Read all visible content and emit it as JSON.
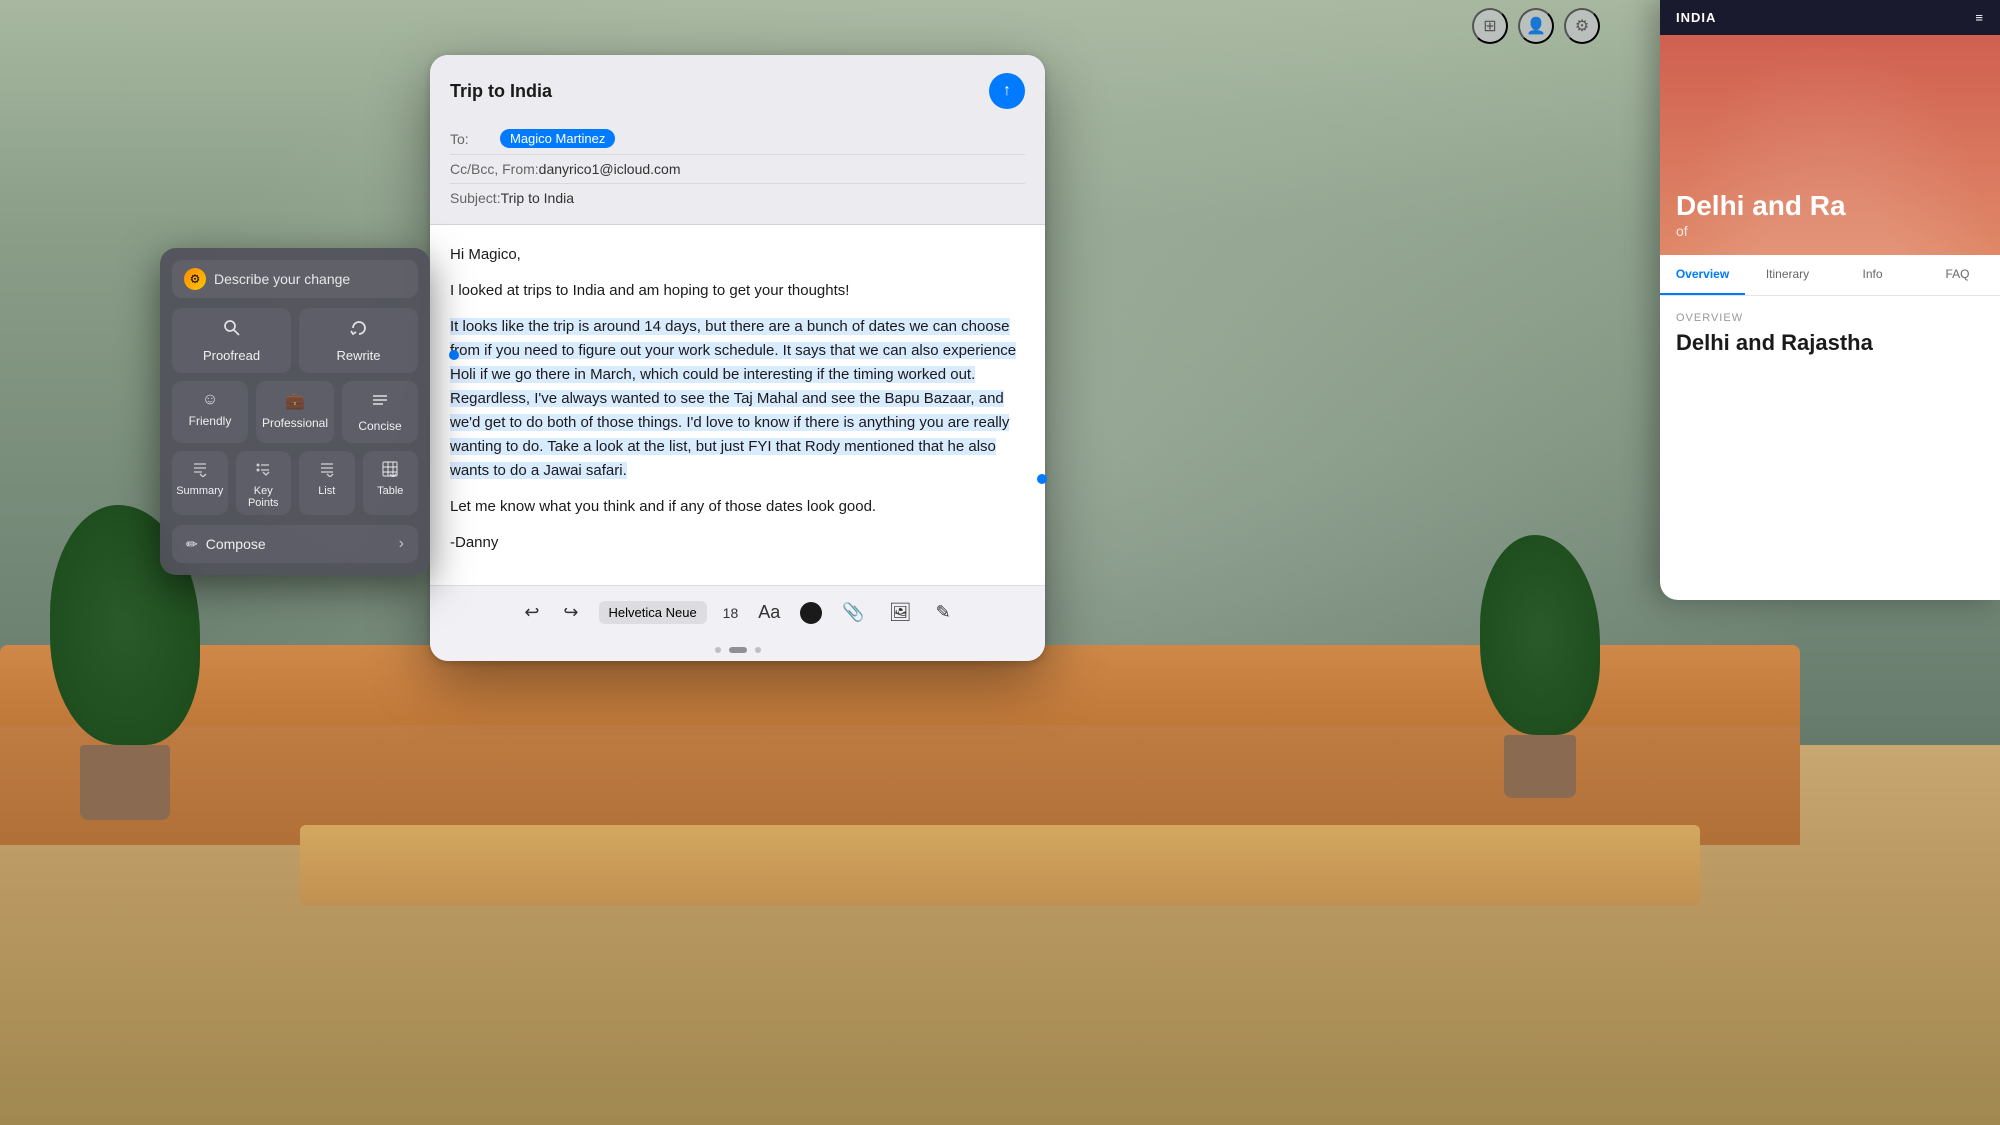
{
  "background": {
    "color": "#7a9e8a"
  },
  "top_controls": {
    "btn1_icon": "⊞",
    "btn2_icon": "👤",
    "btn3_icon": "⚙"
  },
  "email_window": {
    "title": "Trip to India",
    "send_icon": "↑",
    "to_label": "To:",
    "recipient": "Magico Martinez",
    "ccbcc_label": "Cc/Bcc, From:",
    "from_email": "danyrico1@icloud.com",
    "subject_label": "Subject:",
    "subject": "Trip to India",
    "greeting": "Hi Magico,",
    "line1": "I looked at trips to India and am hoping to get your thoughts!",
    "selected_paragraph": "It looks like the trip is around 14 days, but there are a bunch of dates we can choose from if you need to figure out your work schedule. It says that we can also experience Holi if we go there in March, which could be interesting if the timing worked out. Regardless, I've always wanted to see the Taj Mahal and see the Bapu Bazaar, and we'd get to do both of those things.  I'd love to know if there is anything you are really wanting to do. Take a look at the list, but just FYI that Rody mentioned that he also wants to do a Jawai safari.",
    "line2": "Let me know what you think and if any of those dates look good.",
    "signature": "-Danny",
    "toolbar": {
      "undo_icon": "↩",
      "redo_icon": "↪",
      "font_name": "Helvetica Neue",
      "font_size": "18",
      "text_format_icon": "Aa",
      "color_icon": "●",
      "attach_icon": "📎",
      "photo_icon": "🖼",
      "markup_icon": "✎"
    },
    "pagination": {
      "dot1": "inactive",
      "dot2": "active",
      "dot3": "inactive"
    }
  },
  "writing_tools": {
    "describe_placeholder": "Describe your change",
    "describe_icon": "⚙",
    "proofread_label": "Proofread",
    "proofread_icon": "🔍",
    "rewrite_label": "Rewrite",
    "rewrite_icon": "↻",
    "friendly_label": "Friendly",
    "friendly_icon": "☺",
    "professional_label": "Professional",
    "professional_icon": "💼",
    "concise_label": "Concise",
    "concise_icon": "≡",
    "summary_label": "Summary",
    "summary_icon": "↓",
    "key_points_label": "Key Points",
    "key_points_icon": "↓",
    "list_label": "List",
    "list_icon": "↓",
    "table_label": "Table",
    "table_icon": "↓",
    "compose_label": "Compose",
    "compose_icon": "✏"
  },
  "travel_panel": {
    "header_country": "INDIA",
    "hero_title": "Delhi and Ra",
    "hero_subtitle": "of",
    "nav": {
      "overview": "Overview",
      "itinerary": "Itinerary",
      "info": "Info",
      "faq": "FAQ"
    },
    "overview_label": "OVERVIEW",
    "overview_title": "Delhi and Rajastha"
  }
}
